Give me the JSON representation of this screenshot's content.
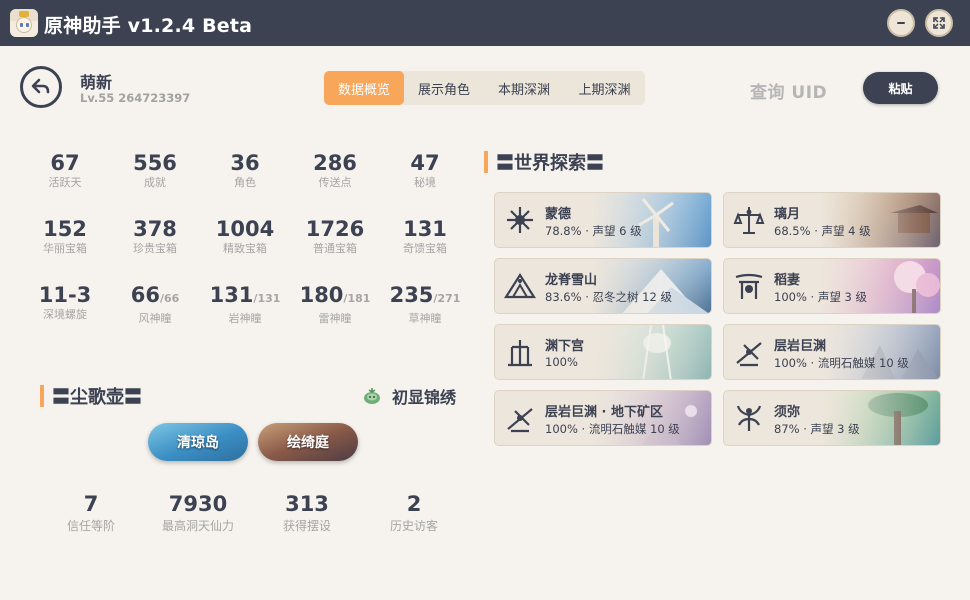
{
  "app": {
    "title": "原神助手 v1.2.4 Beta"
  },
  "user": {
    "name": "萌新",
    "sub": "Lv.55 264723397"
  },
  "tabs": [
    "数据概览",
    "展示角色",
    "本期深渊",
    "上期深渊"
  ],
  "uid": {
    "label": "查询 UID",
    "paste": "粘贴"
  },
  "stats": [
    {
      "value": "67",
      "label": "活跃天"
    },
    {
      "value": "556",
      "label": "成就"
    },
    {
      "value": "36",
      "label": "角色"
    },
    {
      "value": "286",
      "label": "传送点"
    },
    {
      "value": "47",
      "label": "秘境"
    },
    {
      "value": "152",
      "label": "华丽宝箱"
    },
    {
      "value": "378",
      "label": "珍贵宝箱"
    },
    {
      "value": "1004",
      "label": "精致宝箱"
    },
    {
      "value": "1726",
      "label": "普通宝箱"
    },
    {
      "value": "131",
      "label": "奇馈宝箱"
    },
    {
      "value": "11-3",
      "label": "深境螺旋"
    },
    {
      "value": "66",
      "denom": "/66",
      "label": "风神瞳"
    },
    {
      "value": "131",
      "denom": "/131",
      "label": "岩神瞳"
    },
    {
      "value": "180",
      "denom": "/181",
      "label": "雷神瞳"
    },
    {
      "value": "235",
      "denom": "/271",
      "label": "草神瞳"
    }
  ],
  "teapot": {
    "title": "〓尘歌壶〓",
    "rank": "初显锦绣",
    "rank_icon": "teapot-spirit-icon",
    "realms": [
      "清琼岛",
      "绘绮庭"
    ],
    "stats": [
      {
        "value": "7",
        "label": "信任等阶"
      },
      {
        "value": "7930",
        "label": "最高洞天仙力"
      },
      {
        "value": "313",
        "label": "获得摆设"
      },
      {
        "value": "2",
        "label": "历史访客"
      }
    ]
  },
  "exploration": {
    "title": "〓世界探索〓",
    "regions": [
      {
        "name": "蒙德",
        "detail": "78.8% · 声望 6 级",
        "emblem": "mondstadt-emblem-icon"
      },
      {
        "name": "璃月",
        "detail": "68.5% · 声望 4 级",
        "emblem": "liyue-emblem-icon"
      },
      {
        "name": "龙脊雪山",
        "detail": "83.6% · 忍冬之树 12 级",
        "emblem": "dragonspine-emblem-icon"
      },
      {
        "name": "稻妻",
        "detail": "100% · 声望 3 级",
        "emblem": "inazuma-emblem-icon"
      },
      {
        "name": "渊下宫",
        "detail": "100%",
        "emblem": "enkanomiya-emblem-icon"
      },
      {
        "name": "层岩巨渊",
        "detail": "100% · 流明石触媒 10 级",
        "emblem": "chasm-emblem-icon"
      },
      {
        "name": "层岩巨渊 · 地下矿区",
        "detail": "100% · 流明石触媒 10 级",
        "emblem": "chasm-underground-emblem-icon"
      },
      {
        "name": "须弥",
        "detail": "87% · 声望 3 级",
        "emblem": "sumeru-emblem-icon"
      }
    ]
  },
  "colors": {
    "accent": "#f7a65a",
    "dark": "#3d4252",
    "muted": "#a5a5a5",
    "background": "#f6f3ee"
  }
}
